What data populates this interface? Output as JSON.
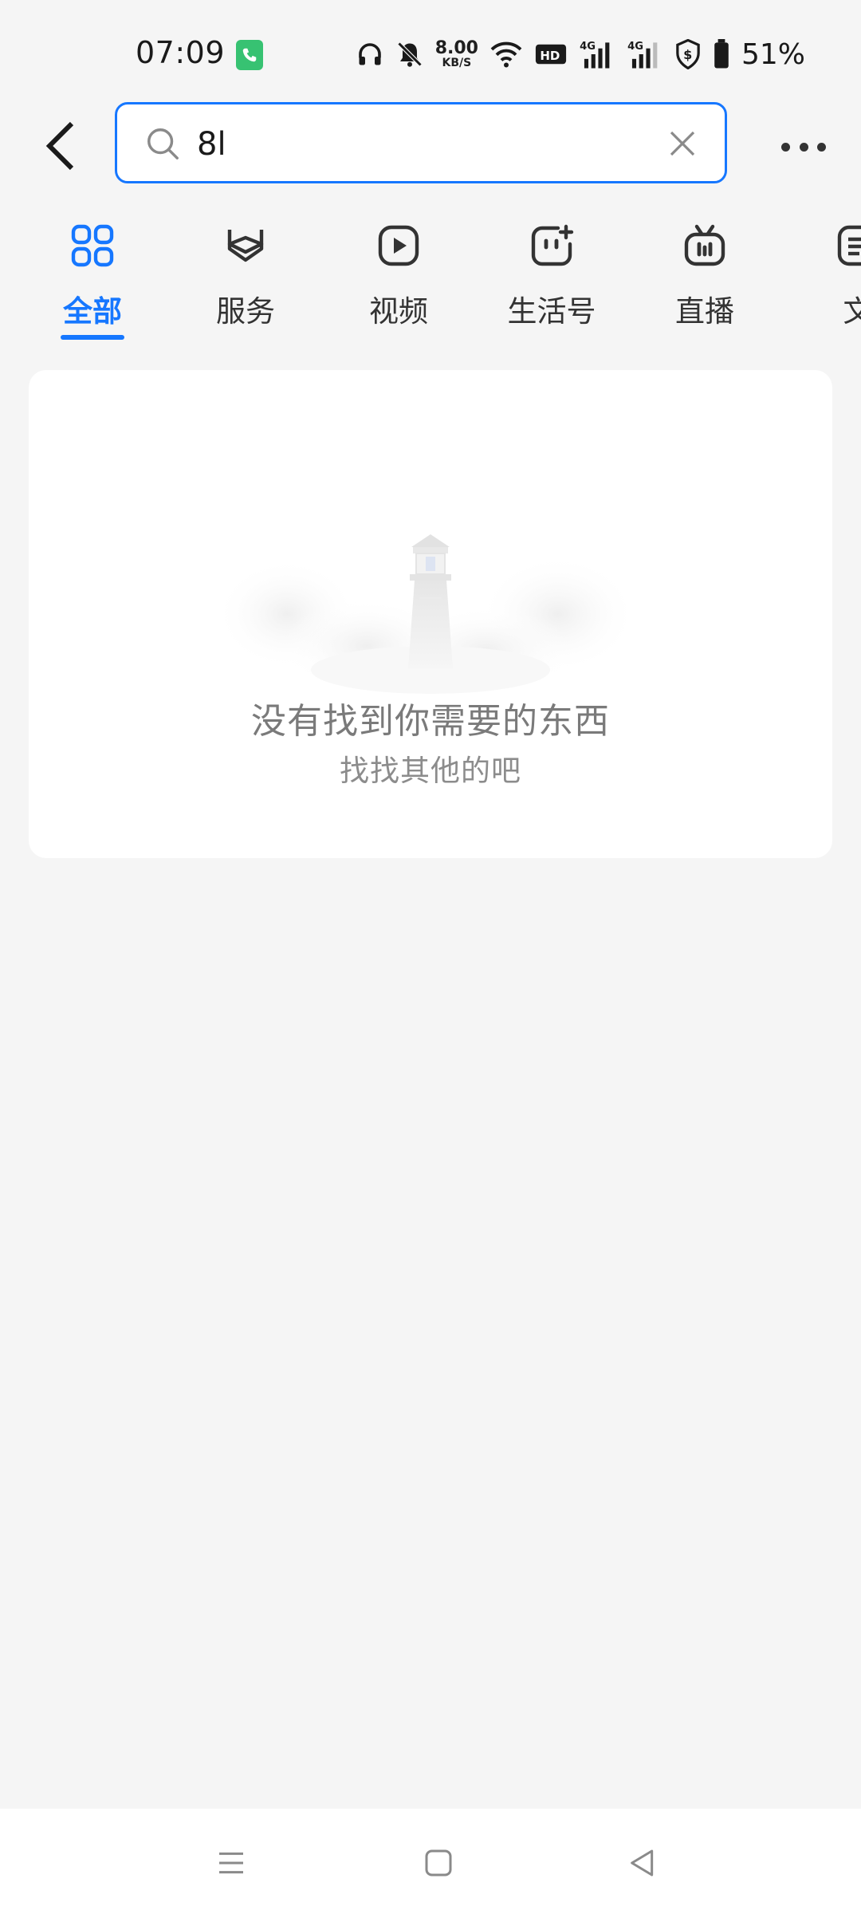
{
  "status_bar": {
    "time": "07:09",
    "net_speed_value": "8.00",
    "net_speed_unit": "KB/S",
    "battery": "51%",
    "icons": [
      "call-indicator-icon",
      "headphones-icon",
      "silent-icon",
      "wifi-icon",
      "hd-icon",
      "signal-4g-icon",
      "signal-4g-icon",
      "security-shield-icon",
      "battery-icon"
    ]
  },
  "search": {
    "value": "8l"
  },
  "tabs": [
    {
      "label": "全部",
      "icon": "grid-icon",
      "active": true
    },
    {
      "label": "服务",
      "icon": "service-icon",
      "active": false
    },
    {
      "label": "视频",
      "icon": "video-play-icon",
      "active": false
    },
    {
      "label": "生活号",
      "icon": "life-account-icon",
      "active": false
    },
    {
      "label": "直播",
      "icon": "live-tv-icon",
      "active": false
    },
    {
      "label": "文",
      "icon": "article-icon",
      "active": false
    }
  ],
  "empty_state": {
    "title": "没有找到你需要的东西",
    "subtitle": "找找其他的吧",
    "illustration": "lighthouse-illustration"
  },
  "nav_bar": {
    "buttons": [
      "menu-icon",
      "home-icon",
      "back-triangle-icon"
    ]
  },
  "colors": {
    "accent": "#1677ff",
    "background": "#f5f5f5",
    "card": "#ffffff",
    "muted_text": "#7a7a7a"
  }
}
